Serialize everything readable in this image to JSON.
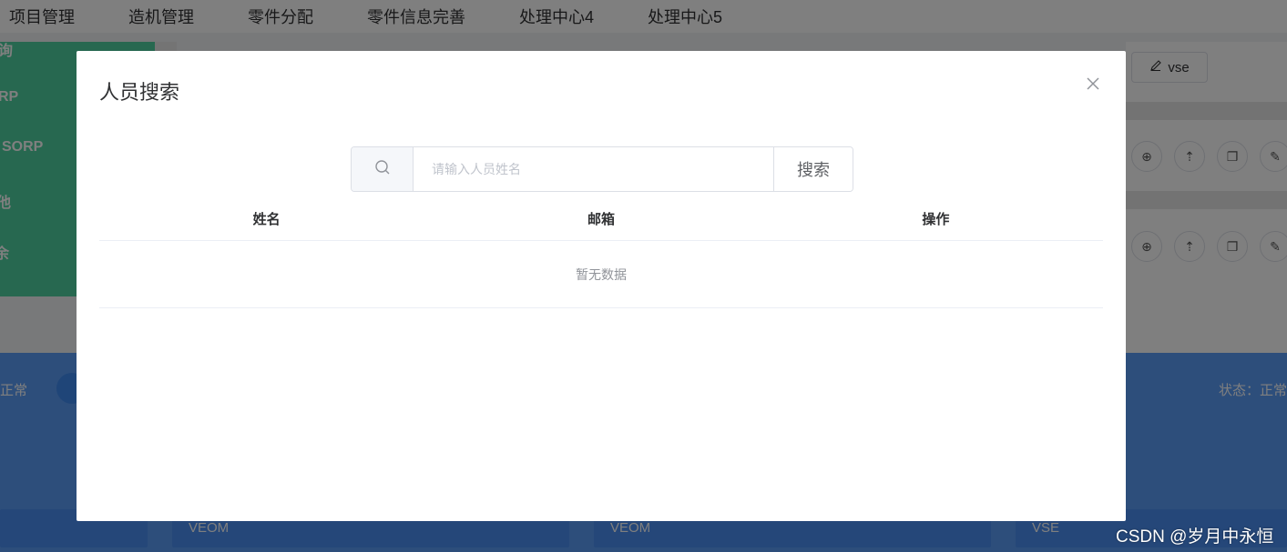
{
  "topnav": {
    "items": [
      {
        "label": "项目管理"
      },
      {
        "label": "造机管理"
      },
      {
        "label": "零件分配"
      },
      {
        "label": "零件信息完善"
      },
      {
        "label": "处理中心4"
      },
      {
        "label": "处理中心5"
      }
    ]
  },
  "sidebar": {
    "items": [
      {
        "label": "询"
      },
      {
        "label": "RP"
      },
      {
        "label": "SORP"
      },
      {
        "label": "他"
      },
      {
        "label": "余"
      }
    ]
  },
  "background": {
    "vse_button_label": "vse",
    "status_left": "正常",
    "status_right": "状态：正常",
    "cards": [
      {
        "label": "VEOM"
      },
      {
        "label": "VEOM"
      },
      {
        "label": "VSE"
      }
    ]
  },
  "dialog": {
    "title": "人员搜索",
    "search": {
      "placeholder": "请输入人员姓名",
      "value": "",
      "button_label": "搜索"
    },
    "table": {
      "columns": [
        "姓名",
        "邮箱",
        "操作"
      ],
      "rows": [],
      "empty_text": "暂无数据"
    }
  },
  "watermark": "CSDN @岁月中永恒",
  "colors": {
    "sidebar_green": "#4fd1a0",
    "band_blue": "#5b9cf6",
    "card_blue": "#4a8ef2",
    "overlay": "rgba(0,0,0,0.5)"
  }
}
